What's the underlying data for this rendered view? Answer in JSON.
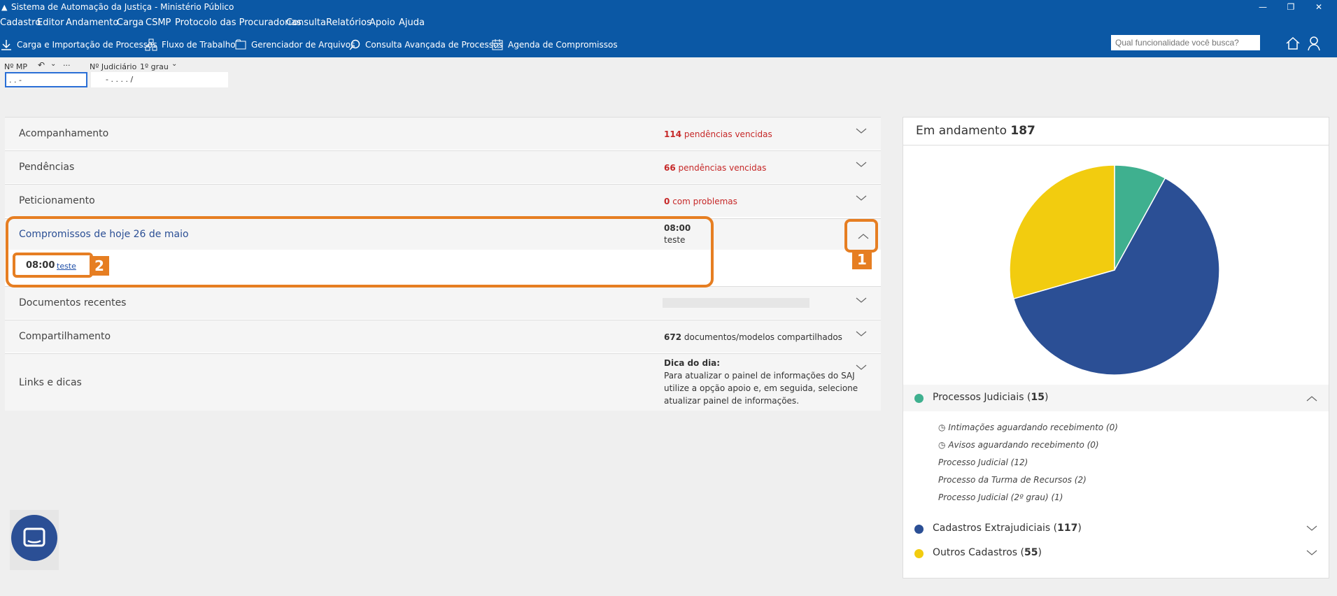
{
  "window": {
    "title": "Sistema de Automação da Justiça - Ministério Público"
  },
  "menu": [
    "Cadastro",
    "Editor",
    "Andamento",
    "Carga",
    "CSMP",
    "Protocolo das Procuradorias",
    "Consulta",
    "Relatórios",
    "Apoio",
    "Ajuda"
  ],
  "toolbar": {
    "items": [
      "Carga e Importação de Processos",
      "Fluxo de Trabalho",
      "Gerenciador de Arquivos",
      "Consulta Avançada de Processos",
      "Agenda de Compromissos"
    ],
    "search_placeholder": "Qual funcionalidade você busca?"
  },
  "process_fields": {
    "mp_label": "Nº MP",
    "mp_more": "···",
    "mp_value": ". .  -",
    "judicial_label": "Nº Judiciário",
    "grau_label": "1º grau",
    "judicial_value": "- .  . . .  /"
  },
  "sections": {
    "acompanhamento": {
      "title": "Acompanhamento",
      "count": "114",
      "suffix": "pendências vencidas"
    },
    "pendencias": {
      "title": "Pendências",
      "count": "66",
      "suffix": "pendências vencidas"
    },
    "peticionamento": {
      "title": "Peticionamento",
      "count": "0",
      "suffix": "com problemas"
    },
    "compromissos": {
      "title": "Compromissos de hoje 26 de maio",
      "time": "08:00",
      "desc": "teste",
      "item_time": "08:00",
      "item_link": "teste"
    },
    "documentos": {
      "title": "Documentos recentes"
    },
    "compartilhamento": {
      "title": "Compartilhamento",
      "count": "672",
      "suffix": "documentos/modelos compartilhados"
    },
    "links": {
      "title": "Links e dicas",
      "tip_title": "Dica do dia:",
      "tip_lines": [
        "Para atualizar o painel de informações do SAJ",
        "utilize a opção apoio e, em seguida, selecione",
        "atualizar painel de informações."
      ]
    }
  },
  "callouts": [
    "1",
    "2"
  ],
  "right_panel": {
    "title": "Em andamento",
    "total": "187",
    "legend": [
      {
        "label": "Processos Judiciais",
        "count": "15",
        "color": "#3fb08f"
      },
      {
        "label": "Cadastros Extrajudiciais",
        "count": "117",
        "color": "#2b4f95"
      },
      {
        "label": "Outros Cadastros",
        "count": "55",
        "color": "#f2cc0f"
      }
    ],
    "sub_items": [
      "Intimações aguardando recebimento (0)",
      "Avisos aguardando recebimento (0)",
      "Processo Judicial (12)",
      "Processo da Turma de Recursos (2)",
      "Processo Judicial (2º grau) (1)"
    ]
  },
  "chart_data": {
    "type": "pie",
    "title": "Em andamento 187",
    "categories": [
      "Processos Judiciais",
      "Cadastros Extrajudiciais",
      "Outros Cadastros"
    ],
    "values": [
      15,
      117,
      55
    ],
    "colors": [
      "#3fb08f",
      "#2b4f95",
      "#f2cc0f"
    ]
  }
}
